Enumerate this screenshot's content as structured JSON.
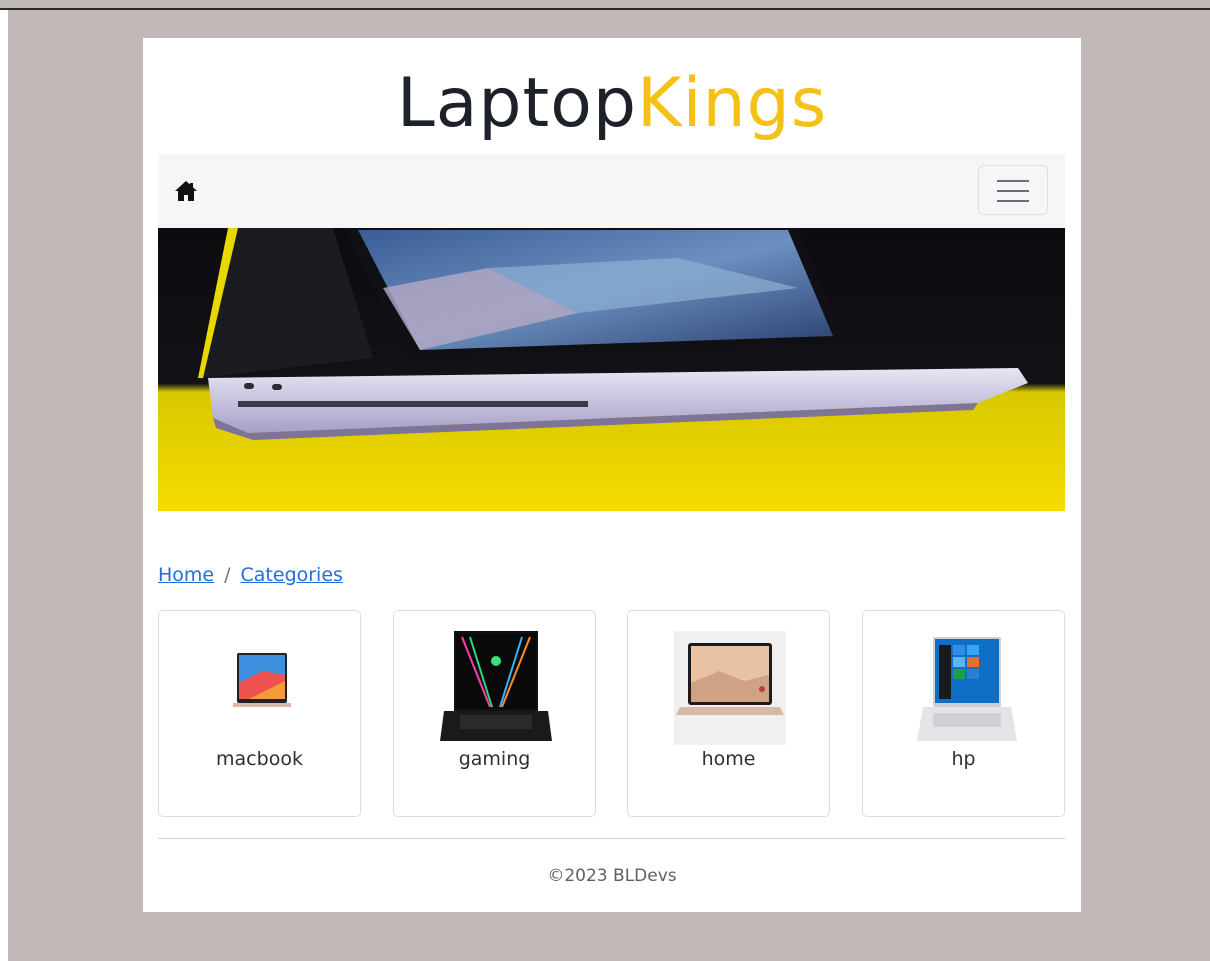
{
  "brand": {
    "part1": "Laptop",
    "part2": "Kings"
  },
  "navbar": {
    "home_icon": "home-icon",
    "menu_icon": "hamburger-menu-icon"
  },
  "breadcrumb": {
    "items": [
      {
        "label": "Home"
      },
      {
        "label": "Categories"
      }
    ],
    "separator": "/"
  },
  "categories": [
    {
      "name": "macbook"
    },
    {
      "name": "gaming"
    },
    {
      "name": "home"
    },
    {
      "name": "hp"
    }
  ],
  "footer": {
    "text": "©2023 BLDevs"
  },
  "colors": {
    "brand_dark": "#1d2228",
    "brand_accent": "#f5c116",
    "page_bg": "#c2b8b8",
    "link": "#1f6fdc"
  }
}
